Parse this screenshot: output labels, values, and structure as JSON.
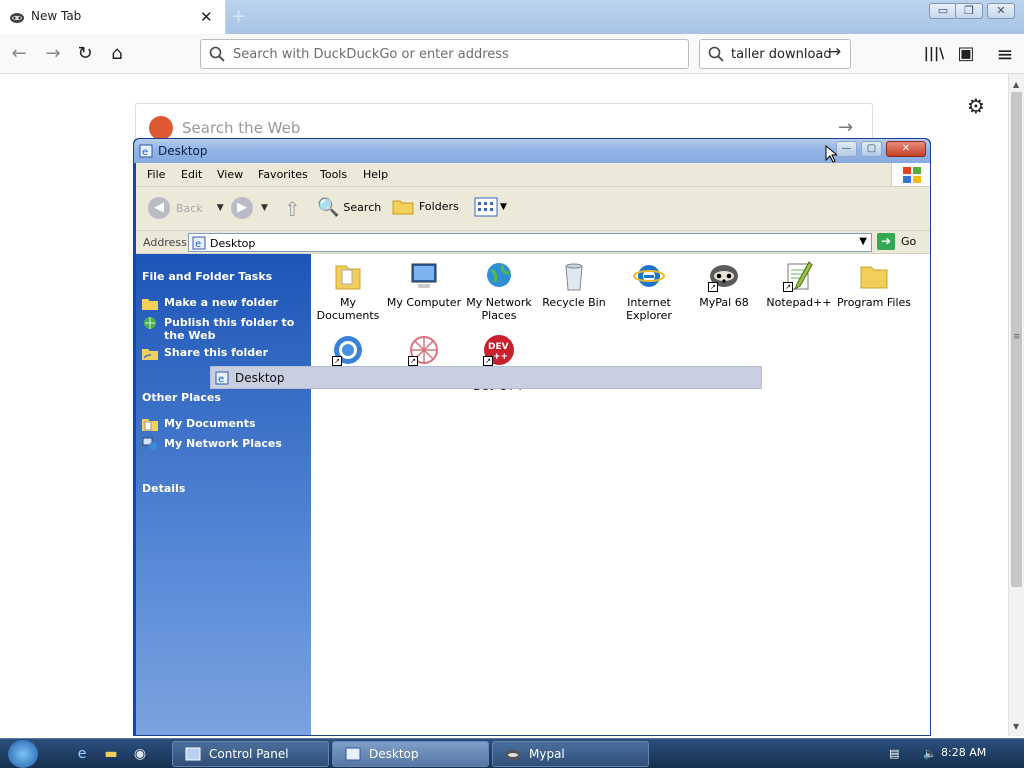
{
  "browser": {
    "tab_title": "New Tab",
    "tab_close": "✕",
    "new_tab": "+",
    "url_placeholder": "Search with DuckDuckGo or enter address",
    "search_text": "taller download",
    "nav": {
      "back": "←",
      "forward": "→",
      "reload": "↻",
      "home": "⌂",
      "library": "|||\\",
      "sidebar": "▣",
      "menu": "≡"
    }
  },
  "page": {
    "search_placeholder": "Search the Web",
    "settings_icon": "⚙"
  },
  "explorer": {
    "title": "Desktop",
    "menu": [
      "File",
      "Edit",
      "View",
      "Favorites",
      "Tools",
      "Help"
    ],
    "toolbar": {
      "back": "Back",
      "search": "Search",
      "folders": "Folders"
    },
    "address_label": "Address",
    "address_value": "Desktop",
    "go_label": "Go",
    "left_pane": {
      "file_tasks_title": "File and Folder Tasks",
      "file_tasks": [
        "Make a new folder",
        "Publish this folder to the Web",
        "Share this folder"
      ],
      "other_places_title": "Other Places",
      "other_places": [
        "My Documents",
        "My Network Places"
      ],
      "details_title": "Details"
    },
    "icons": [
      {
        "label": "My Documents",
        "icon": "folder-documents-icon",
        "shortcut": false
      },
      {
        "label": "My Computer",
        "icon": "computer-icon",
        "shortcut": false
      },
      {
        "label": "My Network Places",
        "icon": "network-globe-icon",
        "shortcut": false
      },
      {
        "label": "Recycle Bin",
        "icon": "recycle-bin-icon",
        "shortcut": false
      },
      {
        "label": "Internet Explorer",
        "icon": "internet-explorer-icon",
        "shortcut": false
      },
      {
        "label": "MyPal 68",
        "icon": "mypal-raccoon-icon",
        "shortcut": true
      },
      {
        "label": "Notepad++",
        "icon": "notepad-plus-plus-icon",
        "shortcut": true
      },
      {
        "label": "Program Files",
        "icon": "folder-icon",
        "shortcut": false
      },
      {
        "label": "",
        "icon": "chromium-icon",
        "shortcut": true
      },
      {
        "label": "",
        "icon": "pink-flower-icon",
        "shortcut": true
      },
      {
        "label": "Dev-C++",
        "icon": "dev-cpp-icon",
        "shortcut": true
      }
    ],
    "drag_tooltip": "Desktop"
  },
  "taskbar": {
    "tasks": [
      "Control Panel",
      "Desktop",
      "Mypal"
    ],
    "active_task": "Desktop",
    "clock": "8:28 AM"
  },
  "colors": {
    "xp_blue": "#0a4ac1",
    "task_pane_top": "#1d55b8",
    "taskbar": "#16304f"
  }
}
